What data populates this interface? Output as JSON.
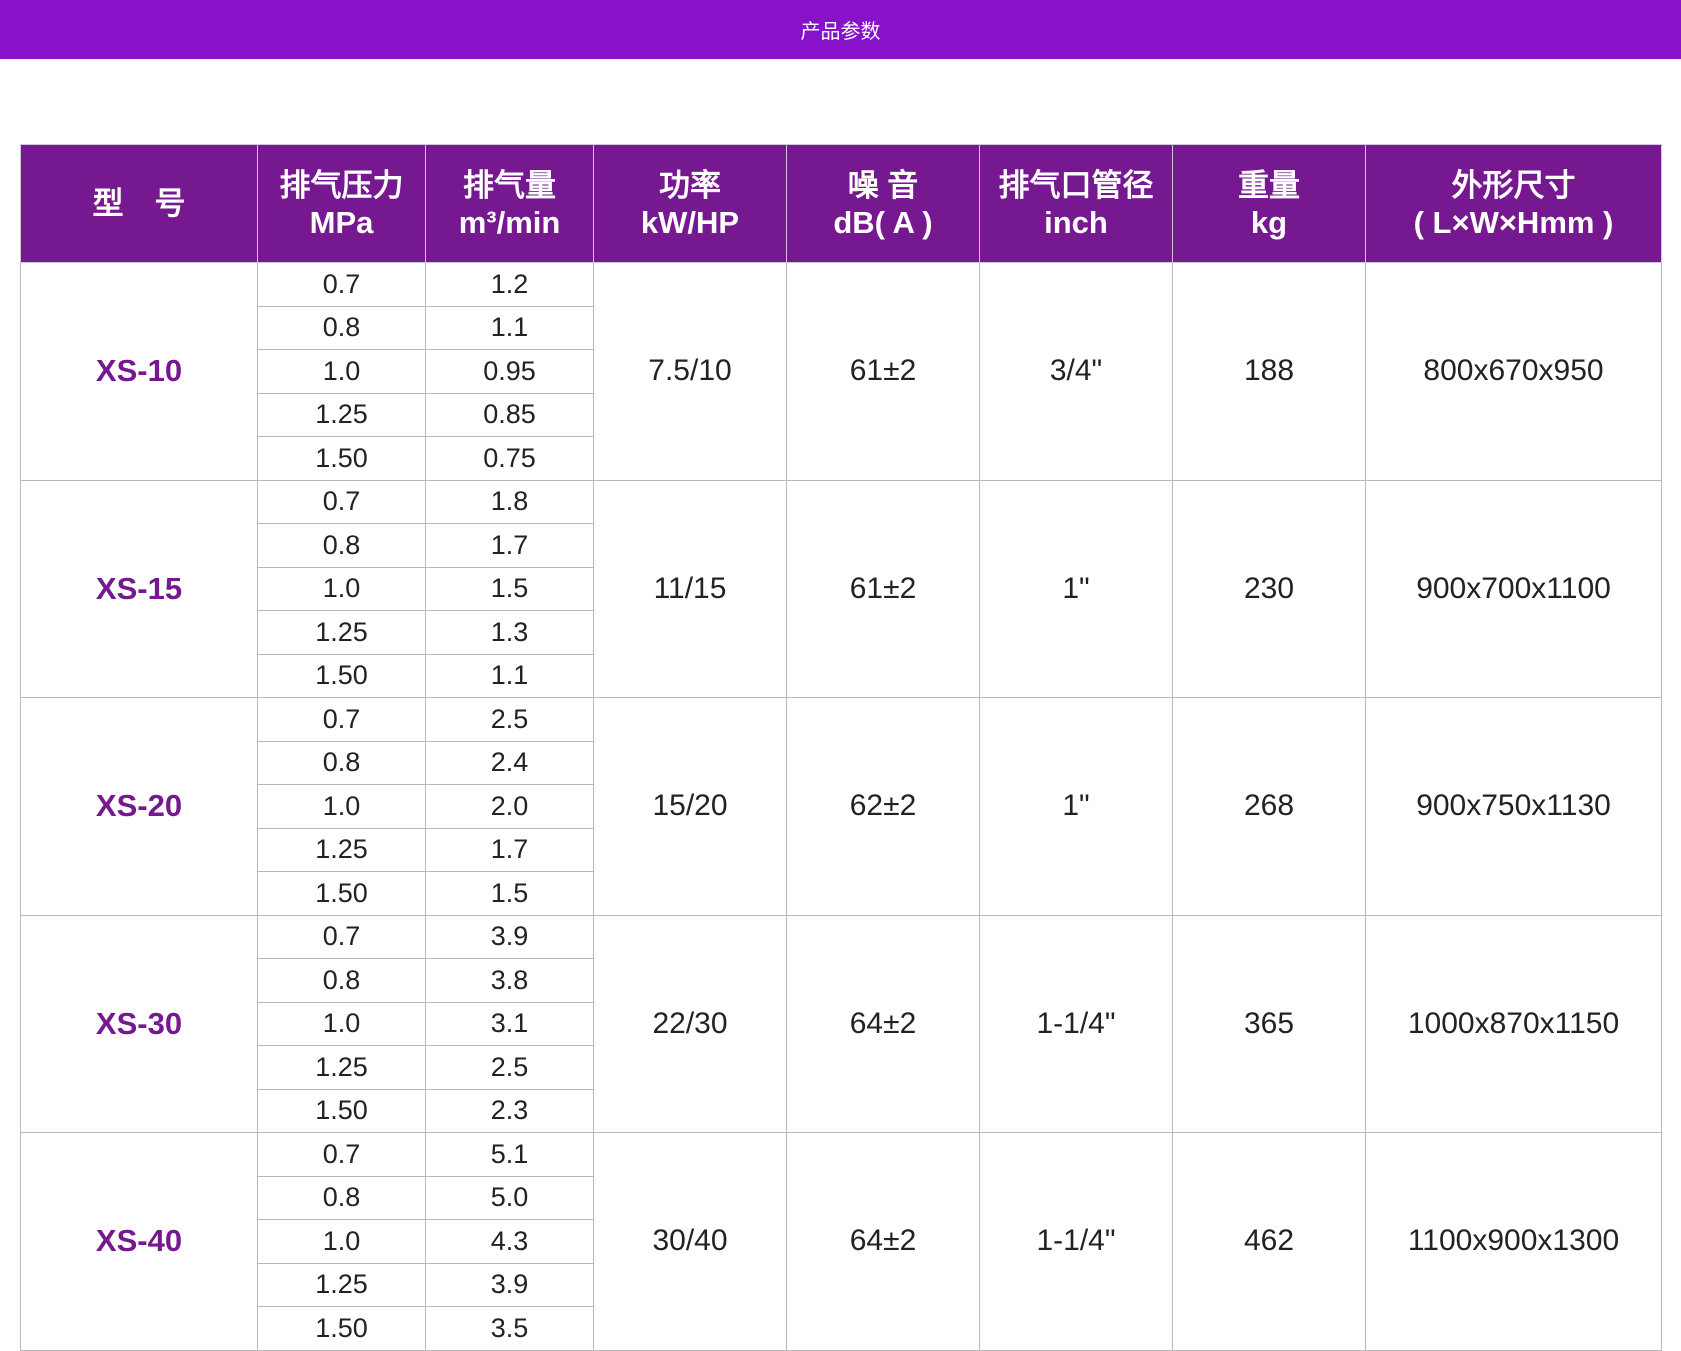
{
  "header": {
    "title": "产品参数"
  },
  "colors": {
    "banner": "#8712c9",
    "table_header": "#76188f",
    "model_text": "#76188f"
  },
  "table": {
    "columns": [
      "型　号",
      "排气压力\nMPa",
      "排气量\nm³/min",
      "功率\nkW/HP",
      "噪 音\ndB( A )",
      "排气口管径\ninch",
      "重量\nkg",
      "外形尺寸\n( L×W×Hmm )"
    ],
    "models": [
      {
        "model": "XS-10",
        "power": "7.5/10",
        "noise": "61±2",
        "outlet": "3/4\"",
        "weight": "188",
        "dimensions": "800x670x950",
        "rows": [
          {
            "pressure": "0.7",
            "flow": "1.2"
          },
          {
            "pressure": "0.8",
            "flow": "1.1"
          },
          {
            "pressure": "1.0",
            "flow": "0.95"
          },
          {
            "pressure": "1.25",
            "flow": "0.85"
          },
          {
            "pressure": "1.50",
            "flow": "0.75"
          }
        ]
      },
      {
        "model": "XS-15",
        "power": "11/15",
        "noise": "61±2",
        "outlet": "1\"",
        "weight": "230",
        "dimensions": "900x700x1100",
        "rows": [
          {
            "pressure": "0.7",
            "flow": "1.8"
          },
          {
            "pressure": "0.8",
            "flow": "1.7"
          },
          {
            "pressure": "1.0",
            "flow": "1.5"
          },
          {
            "pressure": "1.25",
            "flow": "1.3"
          },
          {
            "pressure": "1.50",
            "flow": "1.1"
          }
        ]
      },
      {
        "model": "XS-20",
        "power": "15/20",
        "noise": "62±2",
        "outlet": "1\"",
        "weight": "268",
        "dimensions": "900x750x1130",
        "rows": [
          {
            "pressure": "0.7",
            "flow": "2.5"
          },
          {
            "pressure": "0.8",
            "flow": "2.4"
          },
          {
            "pressure": "1.0",
            "flow": "2.0"
          },
          {
            "pressure": "1.25",
            "flow": "1.7"
          },
          {
            "pressure": "1.50",
            "flow": "1.5"
          }
        ]
      },
      {
        "model": "XS-30",
        "power": "22/30",
        "noise": "64±2",
        "outlet": "1-1/4\"",
        "weight": "365",
        "dimensions": "1000x870x1150",
        "rows": [
          {
            "pressure": "0.7",
            "flow": "3.9"
          },
          {
            "pressure": "0.8",
            "flow": "3.8"
          },
          {
            "pressure": "1.0",
            "flow": "3.1"
          },
          {
            "pressure": "1.25",
            "flow": "2.5"
          },
          {
            "pressure": "1.50",
            "flow": "2.3"
          }
        ]
      },
      {
        "model": "XS-40",
        "power": "30/40",
        "noise": "64±2",
        "outlet": "1-1/4\"",
        "weight": "462",
        "dimensions": "1100x900x1300",
        "rows": [
          {
            "pressure": "0.7",
            "flow": "5.1"
          },
          {
            "pressure": "0.8",
            "flow": "5.0"
          },
          {
            "pressure": "1.0",
            "flow": "4.3"
          },
          {
            "pressure": "1.25",
            "flow": "3.9"
          },
          {
            "pressure": "1.50",
            "flow": "3.5"
          }
        ]
      }
    ]
  }
}
